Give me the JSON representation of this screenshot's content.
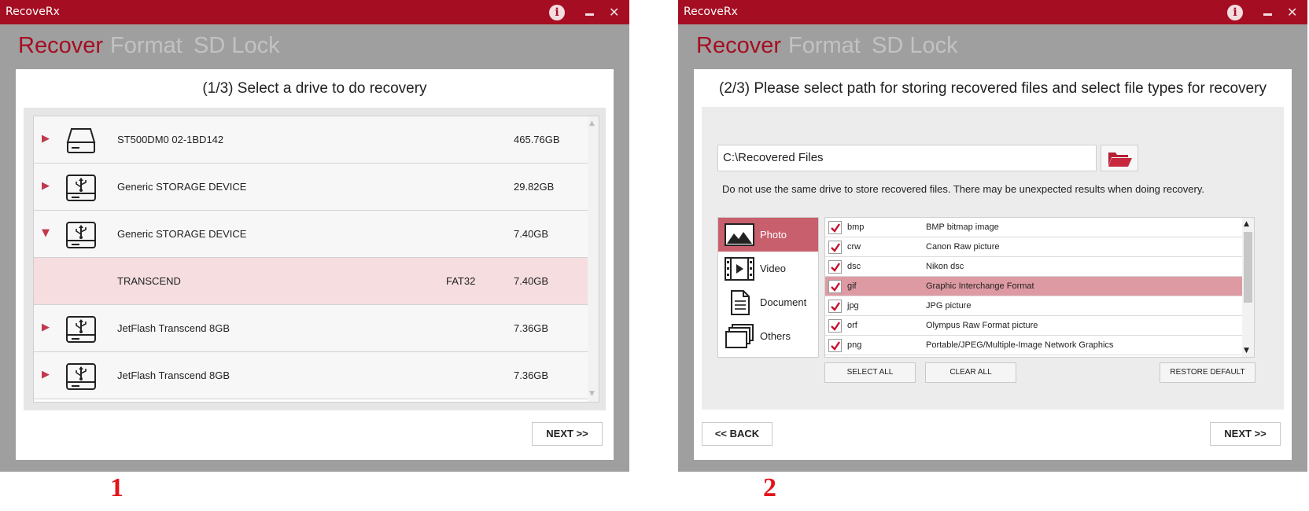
{
  "window1": {
    "title": "RecoveRx",
    "tabs": [
      {
        "label": "Recover",
        "active": true
      },
      {
        "label": "Format",
        "active": false
      },
      {
        "label": "SD Lock",
        "active": false
      }
    ],
    "heading": "(1/3) Select a drive to do recovery",
    "drives": [
      {
        "name": "ST500DM0 02-1BD142",
        "size": "465.76GB",
        "fs": "",
        "icon": "hard-drive-icon",
        "expander": "▶"
      },
      {
        "name": "Generic STORAGE DEVICE",
        "size": "29.82GB",
        "fs": "",
        "icon": "usb-drive-icon",
        "expander": "▶"
      },
      {
        "name": "Generic STORAGE DEVICE",
        "size": "7.40GB",
        "fs": "",
        "icon": "usb-drive-icon",
        "expander": "▼"
      },
      {
        "name": "TRANSCEND",
        "size": "7.40GB",
        "fs": "FAT32",
        "icon": "",
        "expander": "",
        "selected": true
      },
      {
        "name": "JetFlash Transcend 8GB",
        "size": "7.36GB",
        "fs": "",
        "icon": "usb-drive-icon",
        "expander": "▶"
      },
      {
        "name": "JetFlash Transcend 8GB",
        "size": "7.36GB",
        "fs": "",
        "icon": "usb-drive-icon",
        "expander": "▶"
      }
    ],
    "next_label": "NEXT  >>"
  },
  "window2": {
    "title": "RecoveRx",
    "tabs": [
      {
        "label": "Recover",
        "active": true
      },
      {
        "label": "Format",
        "active": false
      },
      {
        "label": "SD Lock",
        "active": false
      }
    ],
    "heading": "(2/3) Please select path for storing recovered files and select file types for recovery",
    "path_value": "C:\\Recovered Files",
    "warning": "Do not use the same drive to store recovered files. There may be unexpected results when doing recovery.",
    "categories": [
      {
        "label": "Photo",
        "icon": "photo-icon",
        "active": true
      },
      {
        "label": "Video",
        "icon": "video-icon",
        "active": false
      },
      {
        "label": "Document",
        "icon": "document-icon",
        "active": false
      },
      {
        "label": "Others",
        "icon": "others-icon",
        "active": false
      }
    ],
    "file_types": [
      {
        "ext": "bmp",
        "desc": "BMP bitmap image",
        "checked": true
      },
      {
        "ext": "crw",
        "desc": "Canon Raw picture",
        "checked": true
      },
      {
        "ext": "dsc",
        "desc": "Nikon dsc",
        "checked": true
      },
      {
        "ext": "gif",
        "desc": "Graphic Interchange Format",
        "checked": true,
        "selected": true
      },
      {
        "ext": "jpg",
        "desc": "JPG picture",
        "checked": true
      },
      {
        "ext": "orf",
        "desc": "Olympus Raw Format picture",
        "checked": true
      },
      {
        "ext": "png",
        "desc": "Portable/JPEG/Multiple-Image Network Graphics",
        "checked": true
      }
    ],
    "select_all_label": "SELECT ALL",
    "clear_all_label": "CLEAR ALL",
    "restore_default_label": "RESTORE DEFAULT",
    "back_label": "<<  BACK",
    "next_label": "NEXT  >>"
  },
  "step_labels": [
    "1",
    "2"
  ],
  "colors": {
    "brand": "#a50e22",
    "selected_row": "#f5dde0",
    "active_category": "#c85f6d",
    "selected_type": "#de9aa3"
  }
}
